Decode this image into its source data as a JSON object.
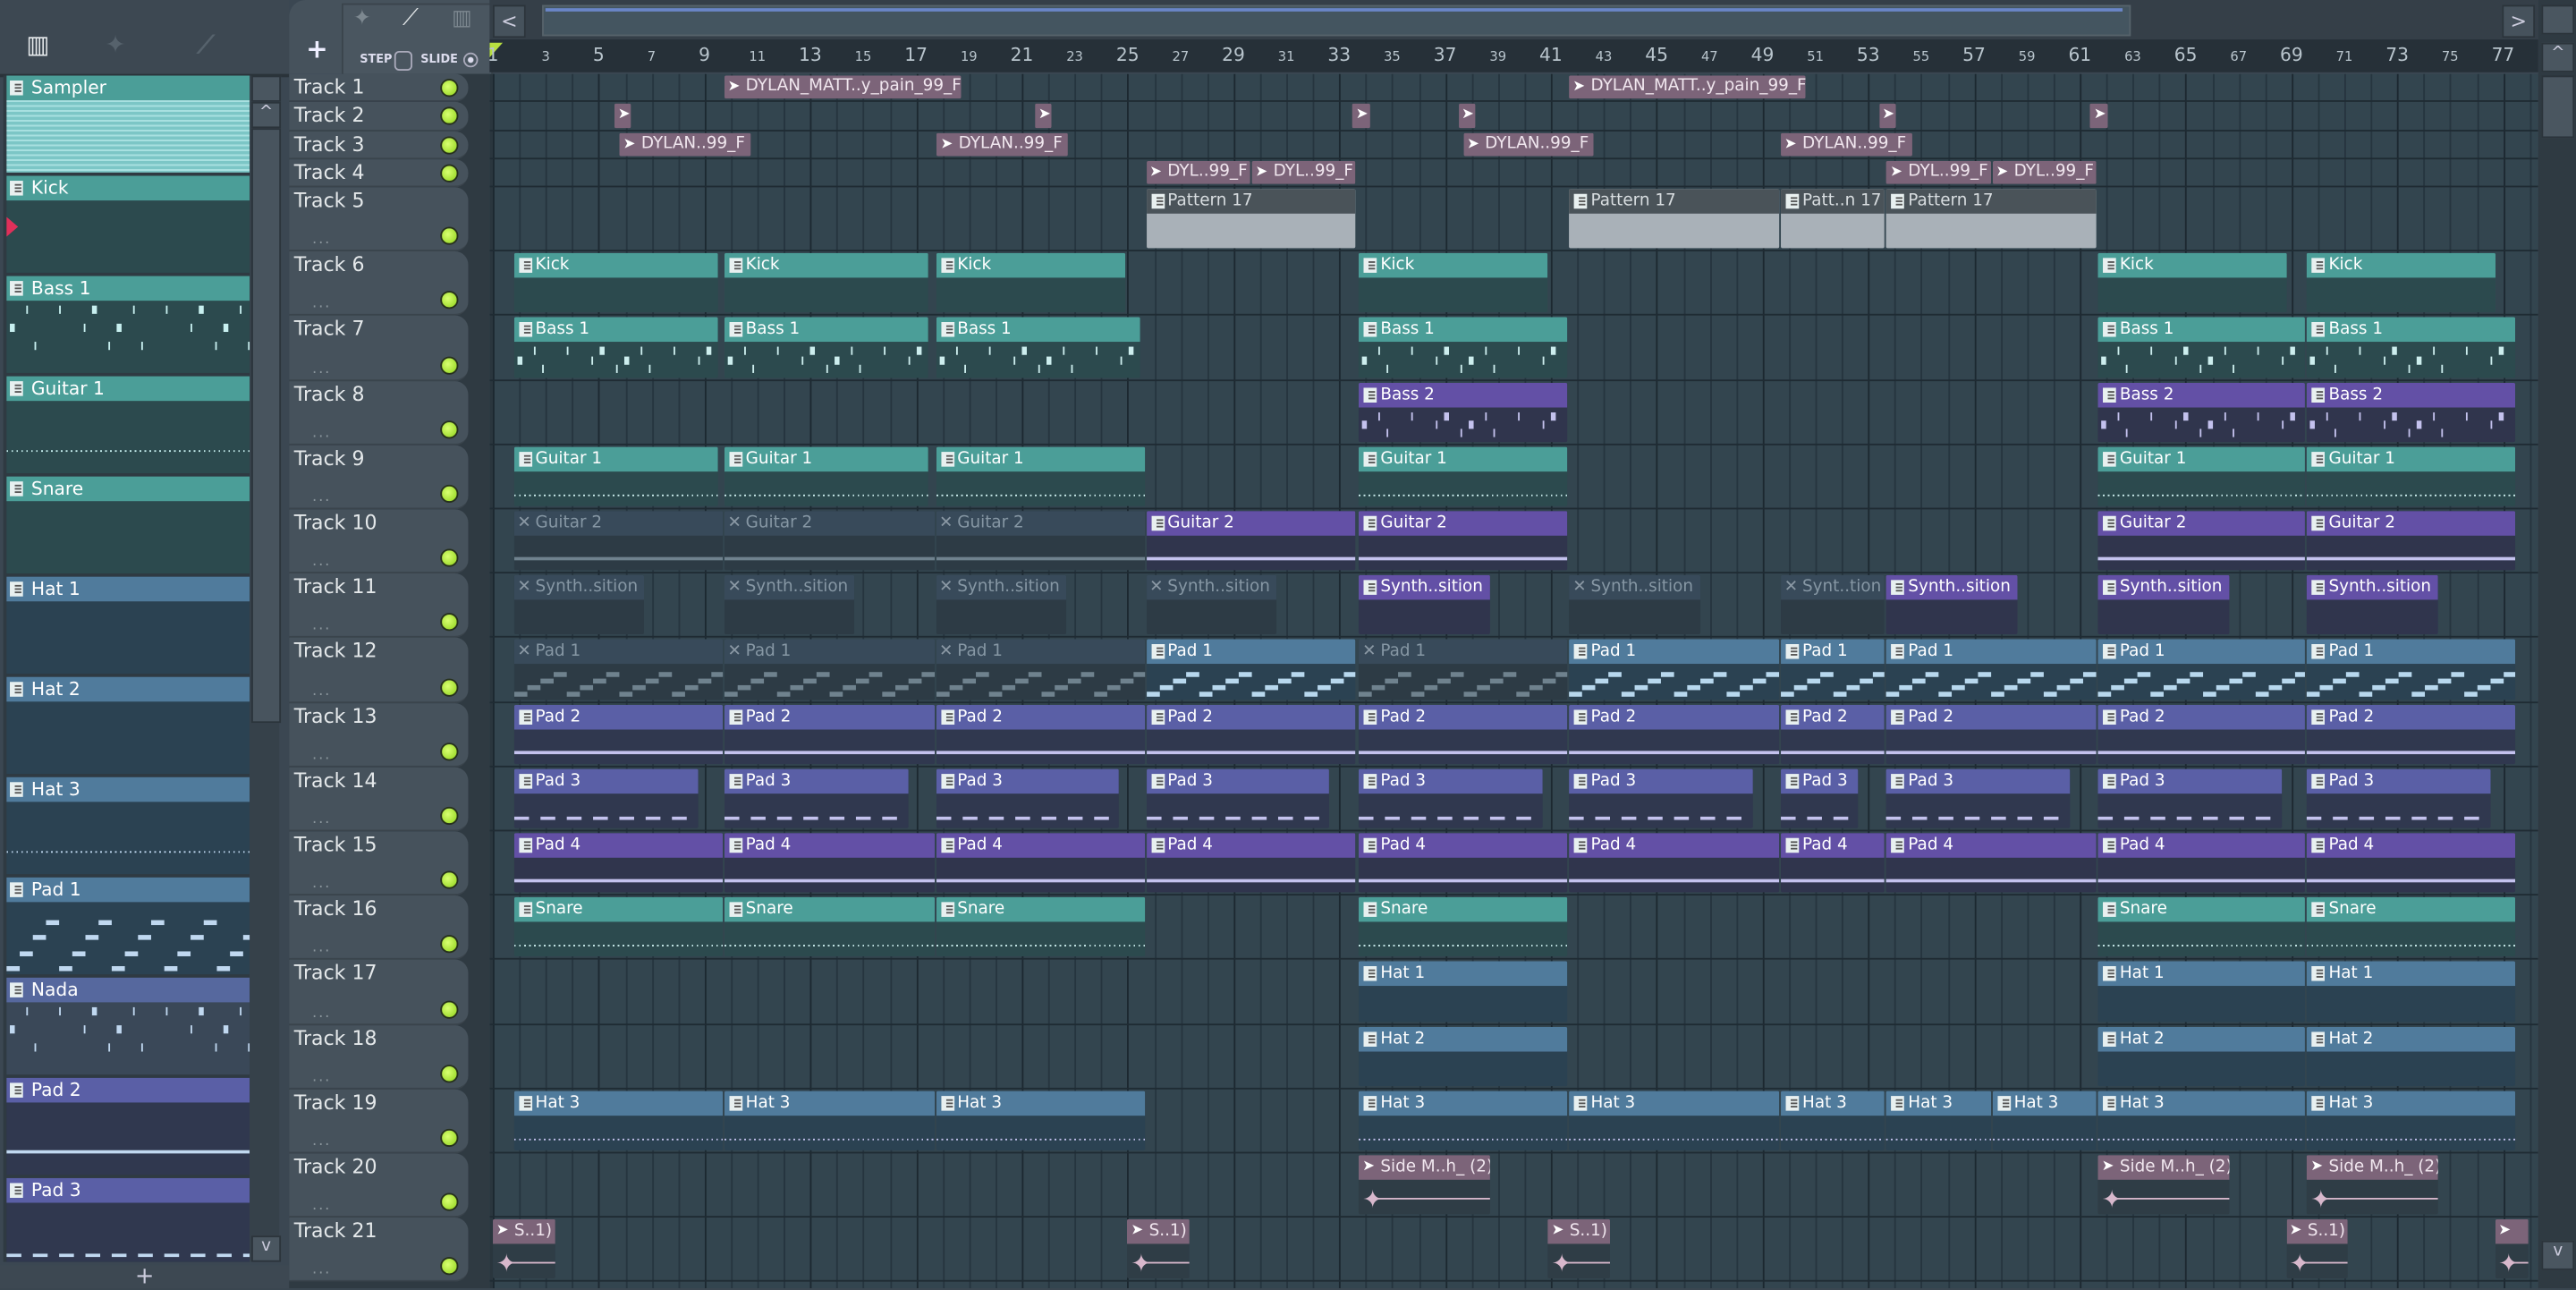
{
  "toolbar": {
    "add_label": "+",
    "step_label": "STEP",
    "slide_label": "SLIDE",
    "scroll_left": "<",
    "scroll_right": ">",
    "scroll_up": "^",
    "scroll_down": "v",
    "browser_add": "+"
  },
  "browser": {
    "items": [
      {
        "name": "Sampler",
        "style": "teal",
        "preview": "sampler"
      },
      {
        "name": "Kick",
        "style": "teal",
        "preview": "none"
      },
      {
        "name": "Bass 1",
        "style": "teal",
        "preview": "ticks"
      },
      {
        "name": "Guitar 1",
        "style": "teal",
        "preview": "dots"
      },
      {
        "name": "Snare",
        "style": "teal",
        "preview": "none"
      },
      {
        "name": "Hat 1",
        "style": "blue",
        "preview": "none"
      },
      {
        "name": "Hat 2",
        "style": "blue",
        "preview": "none"
      },
      {
        "name": "Hat 3",
        "style": "blue",
        "preview": "dots"
      },
      {
        "name": "Pad 1",
        "style": "blue",
        "preview": "stairs"
      },
      {
        "name": "Nada",
        "style": "nada",
        "preview": "ticks"
      },
      {
        "name": "Pad 2",
        "style": "indigo",
        "preview": "line"
      },
      {
        "name": "Pad 3",
        "style": "indigo",
        "preview": "dashes"
      }
    ]
  },
  "ruler": {
    "first_bar": 1,
    "last_bar": 77
  },
  "tracks": [
    {
      "name": "Track 1",
      "clips": [
        {
          "n": "DYLAN_MATT..y_pain_99_F",
          "s": 9.75,
          "l": 9,
          "c": "audio"
        },
        {
          "n": "DYLAN_MATT..y_pain_99_F",
          "s": 41.7,
          "l": 9,
          "c": "audio"
        }
      ]
    },
    {
      "name": "Track 2",
      "clips": [
        {
          "n": "",
          "s": 5.6,
          "l": 0.7,
          "c": "audio"
        },
        {
          "n": "",
          "s": 21.5,
          "l": 0.7,
          "c": "audio"
        },
        {
          "n": "",
          "s": 33.5,
          "l": 0.7,
          "c": "audio"
        },
        {
          "n": "",
          "s": 37.5,
          "l": 0.7,
          "c": "audio"
        },
        {
          "n": "",
          "s": 53.4,
          "l": 0.7,
          "c": "audio"
        },
        {
          "n": "",
          "s": 61.4,
          "l": 0.7,
          "c": "audio"
        }
      ]
    },
    {
      "name": "Track 3",
      "clips": [
        {
          "n": "DYLAN..99_F",
          "s": 5.8,
          "l": 5,
          "c": "audio"
        },
        {
          "n": "DYLAN..99_F",
          "s": 17.8,
          "l": 5,
          "c": "audio"
        },
        {
          "n": "DYLAN..99_F",
          "s": 37.7,
          "l": 5,
          "c": "audio"
        },
        {
          "n": "DYLAN..99_F",
          "s": 49.7,
          "l": 5,
          "c": "audio"
        }
      ]
    },
    {
      "name": "Track 4",
      "clips": [
        {
          "n": "DYL..99_F",
          "s": 25.7,
          "l": 4,
          "c": "audio"
        },
        {
          "n": "DYL..99_F",
          "s": 29.7,
          "l": 4,
          "c": "audio"
        },
        {
          "n": "DYL..99_F",
          "s": 53.7,
          "l": 4,
          "c": "audio"
        },
        {
          "n": "DYL..99_F",
          "s": 57.7,
          "l": 4,
          "c": "audio"
        }
      ]
    },
    {
      "name": "Track 5",
      "clips": [
        {
          "n": "Pattern 17",
          "s": 25.7,
          "l": 8,
          "c": "gray"
        },
        {
          "n": "Pattern 17",
          "s": 41.7,
          "l": 8,
          "c": "gray"
        },
        {
          "n": "Patt..n 17",
          "s": 49.7,
          "l": 4,
          "c": "gray"
        },
        {
          "n": "Pattern 17",
          "s": 53.7,
          "l": 8,
          "c": "gray"
        }
      ]
    },
    {
      "name": "Track 6",
      "clips": [
        {
          "n": "Kick",
          "s": 1.8,
          "l": 7.8,
          "c": "teal"
        },
        {
          "n": "Kick",
          "s": 9.75,
          "l": 7.8,
          "c": "teal"
        },
        {
          "n": "Kick",
          "s": 17.75,
          "l": 7.2,
          "c": "teal"
        },
        {
          "n": "Kick",
          "s": 33.75,
          "l": 7.2,
          "c": "teal"
        },
        {
          "n": "Kick",
          "s": 61.7,
          "l": 7.2,
          "c": "teal"
        },
        {
          "n": "Kick",
          "s": 69.6,
          "l": 7.2,
          "c": "teal"
        }
      ]
    },
    {
      "name": "Track 7",
      "clips": [
        {
          "n": "Bass 1",
          "s": 1.8,
          "l": 7.8,
          "c": "teal"
        },
        {
          "n": "Bass 1",
          "s": 9.75,
          "l": 7.8,
          "c": "teal"
        },
        {
          "n": "Bass 1",
          "s": 17.75,
          "l": 7.8,
          "c": "teal"
        },
        {
          "n": "Bass 1",
          "s": 33.75,
          "l": 7.95,
          "c": "teal"
        },
        {
          "n": "Bass 1",
          "s": 61.7,
          "l": 7.9,
          "c": "teal"
        },
        {
          "n": "Bass 1",
          "s": 69.6,
          "l": 7.9,
          "c": "teal"
        }
      ]
    },
    {
      "name": "Track 8",
      "clips": [
        {
          "n": "Bass 2",
          "s": 33.75,
          "l": 7.95,
          "c": "purple"
        },
        {
          "n": "Bass 2",
          "s": 61.7,
          "l": 7.9,
          "c": "purple"
        },
        {
          "n": "Bass 2",
          "s": 69.6,
          "l": 7.9,
          "c": "purple"
        }
      ]
    },
    {
      "name": "Track 9",
      "clips": [
        {
          "n": "Guitar 1",
          "s": 1.8,
          "l": 7.8,
          "c": "teal"
        },
        {
          "n": "Guitar 1",
          "s": 9.75,
          "l": 7.8,
          "c": "teal"
        },
        {
          "n": "Guitar 1",
          "s": 17.75,
          "l": 7.95,
          "c": "teal"
        },
        {
          "n": "Guitar 1",
          "s": 33.75,
          "l": 7.95,
          "c": "teal"
        },
        {
          "n": "Guitar 1",
          "s": 61.7,
          "l": 7.9,
          "c": "teal"
        },
        {
          "n": "Guitar 1",
          "s": 69.6,
          "l": 7.9,
          "c": "teal"
        }
      ]
    },
    {
      "name": "Track 10",
      "clips": [
        {
          "n": "Guitar 2",
          "s": 1.8,
          "l": 7.95,
          "c": "purple",
          "m": true
        },
        {
          "n": "Guitar 2",
          "s": 9.75,
          "l": 8,
          "c": "purple",
          "m": true
        },
        {
          "n": "Guitar 2",
          "s": 17.75,
          "l": 7.95,
          "c": "purple",
          "m": true
        },
        {
          "n": "Guitar 2",
          "s": 25.7,
          "l": 8,
          "c": "purple"
        },
        {
          "n": "Guitar 2",
          "s": 33.75,
          "l": 7.95,
          "c": "purple"
        },
        {
          "n": "Guitar 2",
          "s": 61.7,
          "l": 7.9,
          "c": "purple"
        },
        {
          "n": "Guitar 2",
          "s": 69.6,
          "l": 7.9,
          "c": "purple"
        }
      ]
    },
    {
      "name": "Track 11",
      "clips": [
        {
          "n": "Synth..sition",
          "s": 1.8,
          "l": 5,
          "c": "purple",
          "m": true
        },
        {
          "n": "Synth..sition",
          "s": 9.75,
          "l": 5,
          "c": "purple",
          "m": true
        },
        {
          "n": "Synth..sition",
          "s": 17.75,
          "l": 5,
          "c": "purple",
          "m": true
        },
        {
          "n": "Synth..sition",
          "s": 25.7,
          "l": 5,
          "c": "purple",
          "m": true
        },
        {
          "n": "Synth..sition",
          "s": 33.75,
          "l": 5,
          "c": "purple"
        },
        {
          "n": "Synth..sition",
          "s": 41.7,
          "l": 5,
          "c": "purple",
          "m": true
        },
        {
          "n": "Synt..tion",
          "s": 49.7,
          "l": 4,
          "c": "purple",
          "m": true
        },
        {
          "n": "Synth..sition",
          "s": 53.7,
          "l": 5,
          "c": "purple"
        },
        {
          "n": "Synth..sition",
          "s": 61.7,
          "l": 5,
          "c": "purple"
        },
        {
          "n": "Synth..sition",
          "s": 69.6,
          "l": 5,
          "c": "purple"
        }
      ]
    },
    {
      "name": "Track 12",
      "clips": [
        {
          "n": "Pad 1",
          "s": 1.8,
          "l": 7.95,
          "c": "blue",
          "m": true
        },
        {
          "n": "Pad 1",
          "s": 9.75,
          "l": 8,
          "c": "blue",
          "m": true
        },
        {
          "n": "Pad 1",
          "s": 17.75,
          "l": 7.95,
          "c": "blue",
          "m": true
        },
        {
          "n": "Pad 1",
          "s": 25.7,
          "l": 8,
          "c": "blue"
        },
        {
          "n": "Pad 1",
          "s": 33.75,
          "l": 7.95,
          "c": "blue",
          "m": true
        },
        {
          "n": "Pad 1",
          "s": 41.7,
          "l": 8,
          "c": "blue"
        },
        {
          "n": "Pad 1",
          "s": 49.7,
          "l": 4,
          "c": "blue"
        },
        {
          "n": "Pad 1",
          "s": 53.7,
          "l": 8,
          "c": "blue"
        },
        {
          "n": "Pad 1",
          "s": 61.7,
          "l": 7.9,
          "c": "blue"
        },
        {
          "n": "Pad 1",
          "s": 69.6,
          "l": 7.9,
          "c": "blue"
        }
      ]
    },
    {
      "name": "Track 13",
      "clips": [
        {
          "n": "Pad 2",
          "s": 1.8,
          "l": 7.95,
          "c": "indigo"
        },
        {
          "n": "Pad 2",
          "s": 9.75,
          "l": 8,
          "c": "indigo"
        },
        {
          "n": "Pad 2",
          "s": 17.75,
          "l": 7.95,
          "c": "indigo"
        },
        {
          "n": "Pad 2",
          "s": 25.7,
          "l": 8,
          "c": "indigo"
        },
        {
          "n": "Pad 2",
          "s": 33.75,
          "l": 7.95,
          "c": "indigo"
        },
        {
          "n": "Pad 2",
          "s": 41.7,
          "l": 8,
          "c": "indigo"
        },
        {
          "n": "Pad 2",
          "s": 49.7,
          "l": 4,
          "c": "indigo"
        },
        {
          "n": "Pad 2",
          "s": 53.7,
          "l": 8,
          "c": "indigo"
        },
        {
          "n": "Pad 2",
          "s": 61.7,
          "l": 7.9,
          "c": "indigo"
        },
        {
          "n": "Pad 2",
          "s": 69.6,
          "l": 7.9,
          "c": "indigo"
        }
      ]
    },
    {
      "name": "Track 14",
      "clips": [
        {
          "n": "Pad 3",
          "s": 1.8,
          "l": 7,
          "c": "indigo"
        },
        {
          "n": "Pad 3",
          "s": 9.75,
          "l": 7,
          "c": "indigo"
        },
        {
          "n": "Pad 3",
          "s": 17.75,
          "l": 7,
          "c": "indigo"
        },
        {
          "n": "Pad 3",
          "s": 25.7,
          "l": 7,
          "c": "indigo"
        },
        {
          "n": "Pad 3",
          "s": 33.75,
          "l": 7,
          "c": "indigo"
        },
        {
          "n": "Pad 3",
          "s": 41.7,
          "l": 7,
          "c": "indigo"
        },
        {
          "n": "Pad 3",
          "s": 49.7,
          "l": 3,
          "c": "indigo"
        },
        {
          "n": "Pad 3",
          "s": 53.7,
          "l": 7,
          "c": "indigo"
        },
        {
          "n": "Pad 3",
          "s": 61.7,
          "l": 7,
          "c": "indigo"
        },
        {
          "n": "Pad 3",
          "s": 69.6,
          "l": 7,
          "c": "indigo"
        }
      ]
    },
    {
      "name": "Track 15",
      "clips": [
        {
          "n": "Pad 4",
          "s": 1.8,
          "l": 7.95,
          "c": "purple"
        },
        {
          "n": "Pad 4",
          "s": 9.75,
          "l": 8,
          "c": "purple"
        },
        {
          "n": "Pad 4",
          "s": 17.75,
          "l": 7.95,
          "c": "purple"
        },
        {
          "n": "Pad 4",
          "s": 25.7,
          "l": 8,
          "c": "purple"
        },
        {
          "n": "Pad 4",
          "s": 33.75,
          "l": 7.95,
          "c": "purple"
        },
        {
          "n": "Pad 4",
          "s": 41.7,
          "l": 8,
          "c": "purple"
        },
        {
          "n": "Pad 4",
          "s": 49.7,
          "l": 4,
          "c": "purple"
        },
        {
          "n": "Pad 4",
          "s": 53.7,
          "l": 8,
          "c": "purple"
        },
        {
          "n": "Pad 4",
          "s": 61.7,
          "l": 7.9,
          "c": "purple"
        },
        {
          "n": "Pad 4",
          "s": 69.6,
          "l": 7.9,
          "c": "purple"
        }
      ]
    },
    {
      "name": "Track 16",
      "clips": [
        {
          "n": "Snare",
          "s": 1.8,
          "l": 7.95,
          "c": "teal"
        },
        {
          "n": "Snare",
          "s": 9.75,
          "l": 8,
          "c": "teal"
        },
        {
          "n": "Snare",
          "s": 17.75,
          "l": 7.95,
          "c": "teal"
        },
        {
          "n": "Snare",
          "s": 33.75,
          "l": 7.95,
          "c": "teal"
        },
        {
          "n": "Snare",
          "s": 61.7,
          "l": 7.9,
          "c": "teal"
        },
        {
          "n": "Snare",
          "s": 69.6,
          "l": 7.9,
          "c": "teal"
        }
      ]
    },
    {
      "name": "Track 17",
      "clips": [
        {
          "n": "Hat 1",
          "s": 33.75,
          "l": 7.95,
          "c": "blue"
        },
        {
          "n": "Hat 1",
          "s": 61.7,
          "l": 7.9,
          "c": "blue"
        },
        {
          "n": "Hat 1",
          "s": 69.6,
          "l": 7.9,
          "c": "blue"
        }
      ]
    },
    {
      "name": "Track 18",
      "clips": [
        {
          "n": "Hat 2",
          "s": 33.75,
          "l": 7.95,
          "c": "blue"
        },
        {
          "n": "Hat 2",
          "s": 61.7,
          "l": 7.9,
          "c": "blue"
        },
        {
          "n": "Hat 2",
          "s": 69.6,
          "l": 7.9,
          "c": "blue"
        }
      ]
    },
    {
      "name": "Track 19",
      "clips": [
        {
          "n": "Hat 3",
          "s": 1.8,
          "l": 7.95,
          "c": "blue"
        },
        {
          "n": "Hat 3",
          "s": 9.75,
          "l": 8,
          "c": "blue"
        },
        {
          "n": "Hat 3",
          "s": 17.75,
          "l": 7.95,
          "c": "blue"
        },
        {
          "n": "Hat 3",
          "s": 33.75,
          "l": 7.95,
          "c": "blue"
        },
        {
          "n": "Hat 3",
          "s": 41.7,
          "l": 8,
          "c": "blue"
        },
        {
          "n": "Hat 3",
          "s": 49.7,
          "l": 4,
          "c": "blue"
        },
        {
          "n": "Hat 3",
          "s": 53.7,
          "l": 4,
          "c": "blue"
        },
        {
          "n": "Hat 3",
          "s": 57.7,
          "l": 4,
          "c": "blue"
        },
        {
          "n": "Hat 3",
          "s": 61.7,
          "l": 7.9,
          "c": "blue"
        },
        {
          "n": "Hat 3",
          "s": 69.6,
          "l": 7.9,
          "c": "blue"
        }
      ]
    },
    {
      "name": "Track 20",
      "clips": [
        {
          "n": "Side M..h_ (2)",
          "s": 33.75,
          "l": 5,
          "c": "audio"
        },
        {
          "n": "Side M..h_ (2)",
          "s": 61.7,
          "l": 5,
          "c": "audio"
        },
        {
          "n": "Side M..h_ (2)",
          "s": 69.6,
          "l": 5,
          "c": "audio"
        }
      ]
    },
    {
      "name": "Track 21",
      "clips": [
        {
          "n": "S..1)",
          "s": 1,
          "l": 2.4,
          "c": "audio"
        },
        {
          "n": "S..1)",
          "s": 25,
          "l": 2.4,
          "c": "audio"
        },
        {
          "n": "S..1)",
          "s": 40.9,
          "l": 2.4,
          "c": "audio"
        },
        {
          "n": "S..1)",
          "s": 68.8,
          "l": 2.4,
          "c": "audio"
        },
        {
          "n": "",
          "s": 76.7,
          "l": 1.3,
          "c": "audio"
        }
      ]
    }
  ],
  "colors": {
    "teal": {
      "head": "#4b9e98",
      "body": "#2c4a4e",
      "text": "#ffffff"
    },
    "blue": {
      "head": "#507b9c",
      "body": "#2b4252",
      "text": "#ffffff"
    },
    "purple": {
      "head": "#6350a6",
      "body": "#30354d",
      "text": "#ffffff"
    },
    "indigo": {
      "head": "#5a5fa6",
      "body": "#30384f",
      "text": "#ffffff"
    },
    "nada": {
      "head": "#56689e",
      "body": "#3a4858",
      "text": "#ffffff"
    },
    "audio": {
      "head": "#7c6479",
      "body": "#2f3d46",
      "text": "#f0e6ee"
    },
    "gray": {
      "head": "#4a5359",
      "body": "#a9b1b8",
      "text": "#d8dde0"
    },
    "muted": {
      "head": "#384a5a",
      "body": "#2d3b45",
      "text": "#8697a4"
    },
    "led": "#a8e635"
  }
}
